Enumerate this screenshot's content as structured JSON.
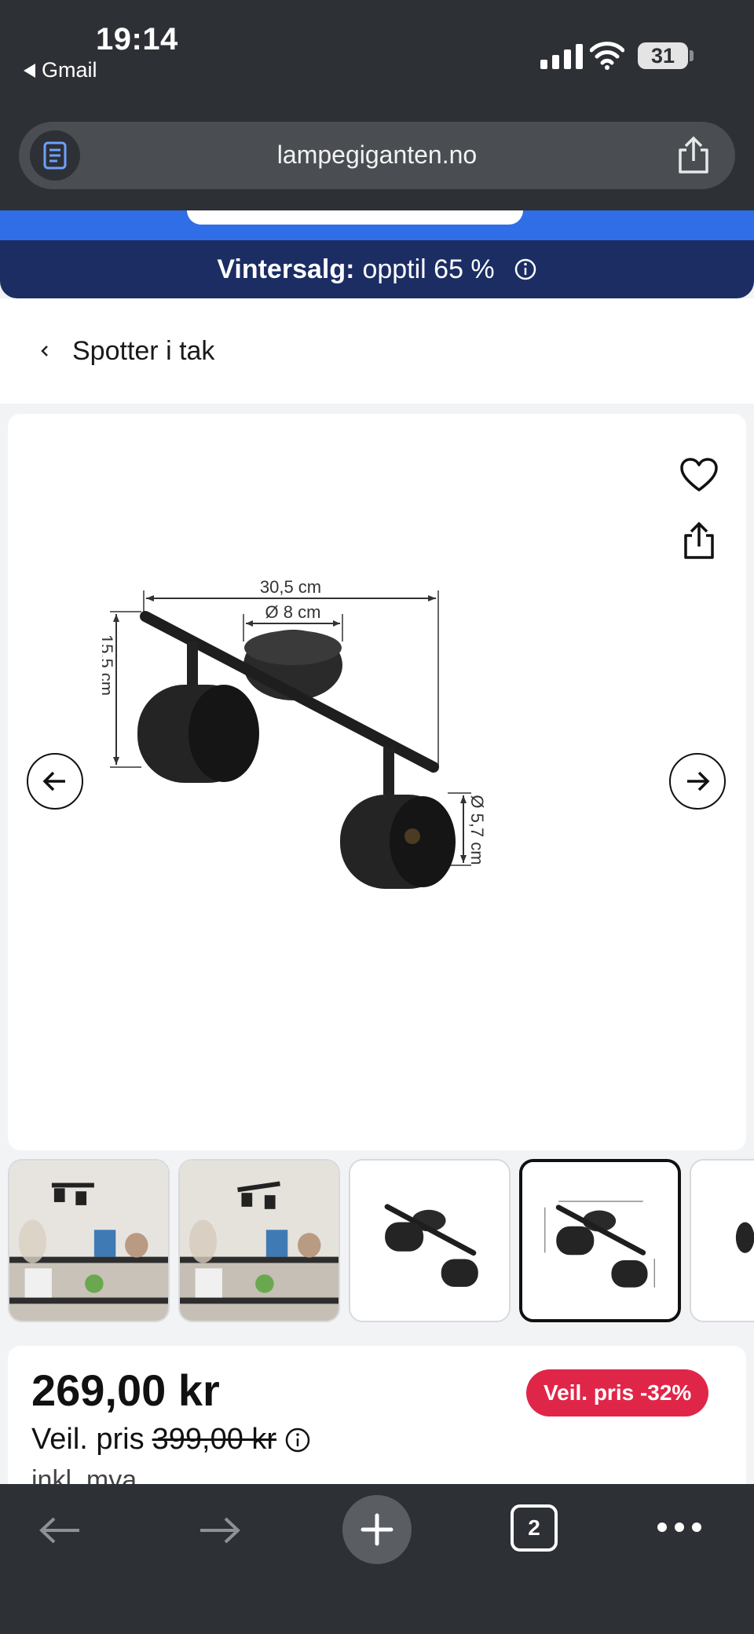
{
  "status_bar": {
    "time": "19:14",
    "back_app": "Gmail",
    "battery": "31"
  },
  "browser": {
    "url": "lampegiganten.no",
    "open_tabs": "2"
  },
  "banner": {
    "bold": "Vintersalg:",
    "text": "opptil 65 %"
  },
  "breadcrumb": {
    "label": "Spotter i tak"
  },
  "product_image": {
    "dim_width": "30,5 cm",
    "dim_base": "Ø 8 cm",
    "dim_height": "15,5 cm",
    "dim_shade": "Ø 5,7 cm"
  },
  "thumbnails": {
    "count_visible": 5,
    "selected_index": 3
  },
  "price": {
    "current": "269,00 kr",
    "old_prefix": "Veil. pris",
    "old_value": "399,00 kr",
    "vat": "inkl. mva.",
    "discount_badge": "Veil. pris -32%"
  },
  "colors": {
    "chrome_bg": "#2d3034",
    "sale_banner": "#1b2d63",
    "accent_blue": "#2f6ee7",
    "discount_red": "#e02648"
  }
}
